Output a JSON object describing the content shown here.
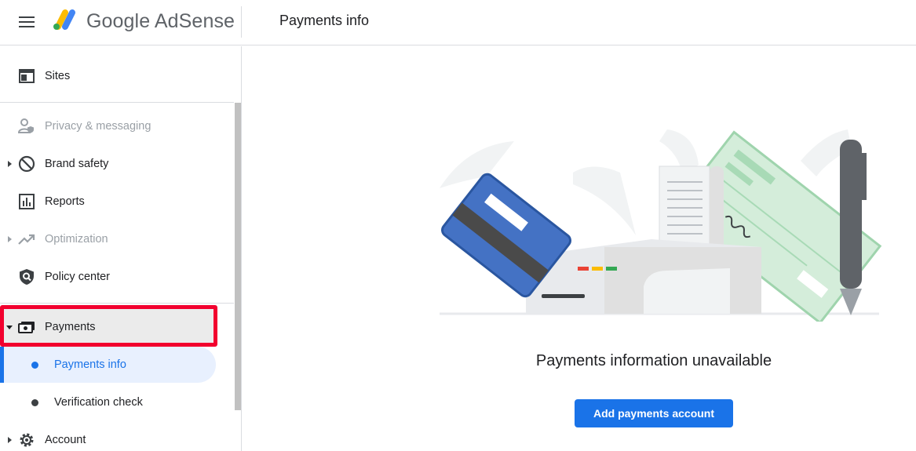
{
  "header": {
    "menu_icon": "hamburger-menu-icon",
    "brand_name": "Google AdSense",
    "page_title": "Payments info"
  },
  "sidebar": {
    "items": [
      {
        "label": "Sites",
        "icon": "sites-icon",
        "disabled": false
      },
      {
        "label": "Privacy & messaging",
        "icon": "privacy-icon",
        "disabled": true
      },
      {
        "label": "Brand safety",
        "icon": "block-icon",
        "disabled": false
      },
      {
        "label": "Reports",
        "icon": "bar-chart-icon",
        "disabled": false
      },
      {
        "label": "Optimization",
        "icon": "trending-up-icon",
        "disabled": true
      },
      {
        "label": "Policy center",
        "icon": "shield-icon",
        "disabled": false
      },
      {
        "label": "Payments",
        "icon": "payments-icon",
        "disabled": false,
        "expanded": true
      },
      {
        "label": "Account",
        "icon": "gear-icon",
        "disabled": false
      }
    ],
    "payments_sub": [
      {
        "label": "Payments info",
        "active": true
      },
      {
        "label": "Verification check",
        "active": false
      }
    ]
  },
  "main": {
    "empty_state_title": "Payments information unavailable",
    "add_button_label": "Add payments account"
  },
  "colors": {
    "accent": "#1a73e8",
    "highlight_border": "#f2002e"
  }
}
